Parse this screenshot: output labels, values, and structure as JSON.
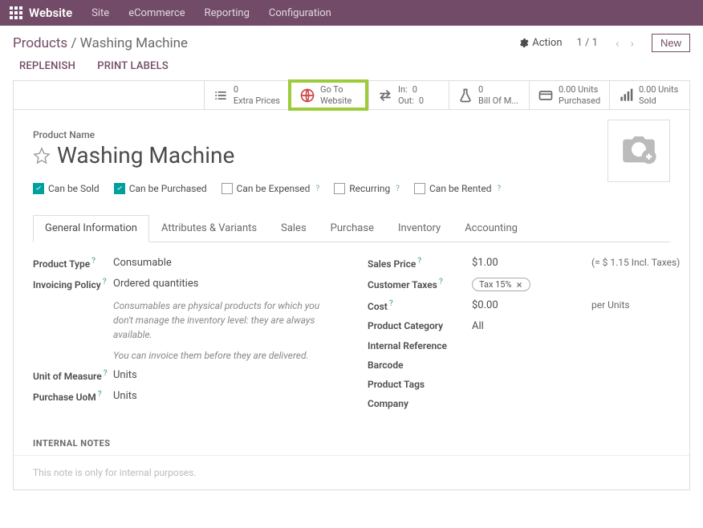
{
  "topbar": {
    "brand": "Website",
    "items": [
      "Site",
      "eCommerce",
      "Reporting",
      "Configuration"
    ]
  },
  "breadcrumb": {
    "parent": "Products",
    "current": "Washing Machine"
  },
  "controls": {
    "action": "Action",
    "pager": "1 / 1",
    "new": "New"
  },
  "sub_actions": [
    "REPLENISH",
    "PRINT LABELS"
  ],
  "stats": {
    "extra_prices": {
      "count": "0",
      "label": "Extra Prices"
    },
    "goto_website": {
      "line1": "Go To",
      "line2": "Website"
    },
    "inout": {
      "in_label": "In:",
      "in_value": "0",
      "out_label": "Out:",
      "out_value": "0"
    },
    "bom": {
      "count": "0",
      "label": "Bill Of M..."
    },
    "purchased": {
      "count": "0.00 Units",
      "label": "Purchased"
    },
    "sold": {
      "count": "0.00 Units",
      "label": "Sold"
    }
  },
  "product": {
    "name_label": "Product Name",
    "name": "Washing Machine"
  },
  "checkboxes": {
    "sold": "Can be Sold",
    "purchased": "Can be Purchased",
    "expensed": "Can be Expensed",
    "recurring": "Recurring",
    "rented": "Can be Rented"
  },
  "tabs": [
    "General Information",
    "Attributes & Variants",
    "Sales",
    "Purchase",
    "Inventory",
    "Accounting"
  ],
  "general": {
    "product_type": {
      "label": "Product Type",
      "value": "Consumable"
    },
    "invoicing_policy": {
      "label": "Invoicing Policy",
      "value": "Ordered quantities"
    },
    "note1": "Consumables are physical products for which you don't manage the inventory level: they are always available.",
    "note2": "You can invoice them before they are delivered.",
    "uom": {
      "label": "Unit of Measure",
      "value": "Units"
    },
    "purchase_uom": {
      "label": "Purchase UoM",
      "value": "Units"
    },
    "sales_price": {
      "label": "Sales Price",
      "value": "$1.00",
      "extra": "(= $ 1.15 Incl. Taxes)"
    },
    "customer_taxes": {
      "label": "Customer Taxes",
      "tag": "Tax 15%"
    },
    "cost": {
      "label": "Cost",
      "value": "$0.00",
      "extra": "per Units"
    },
    "category": {
      "label": "Product Category",
      "value": "All"
    },
    "internal_ref": {
      "label": "Internal Reference"
    },
    "barcode": {
      "label": "Barcode"
    },
    "tags": {
      "label": "Product Tags"
    },
    "company": {
      "label": "Company"
    }
  },
  "notes": {
    "title": "INTERNAL NOTES",
    "placeholder": "This note is only for internal purposes."
  }
}
